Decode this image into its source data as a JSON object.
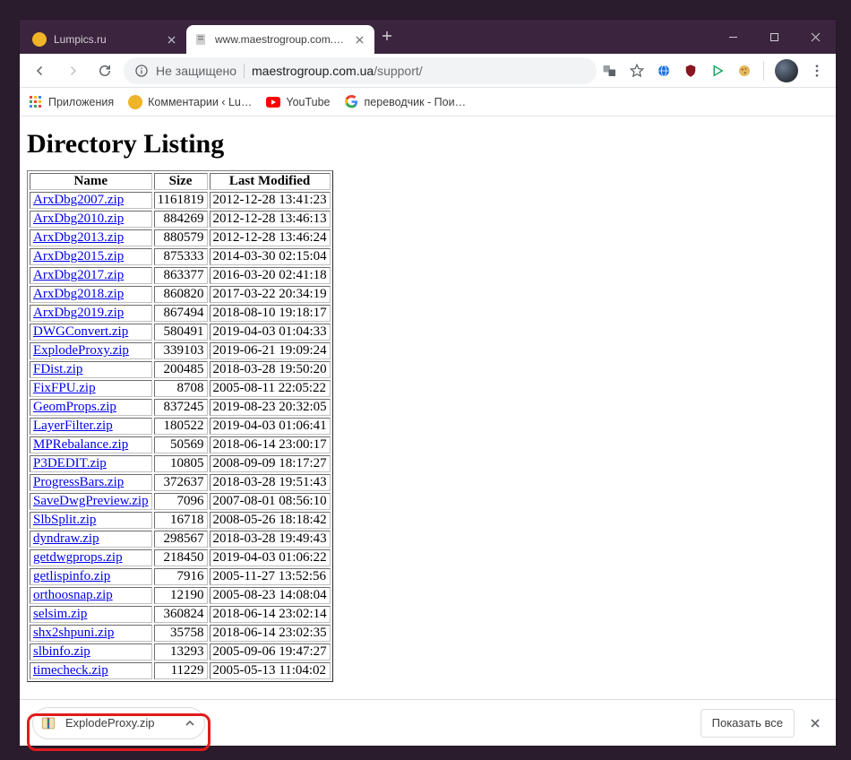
{
  "window": {
    "tabs": [
      {
        "title": "Lumpics.ru",
        "active": false,
        "favicon_color": "#f0b429"
      },
      {
        "title": "www.maestrogroup.com.ua/supp",
        "active": true
      }
    ]
  },
  "toolbar": {
    "secure_label": "Не защищено",
    "url_host": "maestrogroup.com.ua",
    "url_path": "/support/"
  },
  "bookmarks": [
    {
      "label": "Приложения",
      "icon": "apps"
    },
    {
      "label": "Комментарии ‹ Lu…",
      "icon": "lumpics"
    },
    {
      "label": "YouTube",
      "icon": "youtube"
    },
    {
      "label": "переводчик - Пои…",
      "icon": "google-g"
    }
  ],
  "page": {
    "heading": "Directory Listing",
    "columns": [
      "Name",
      "Size",
      "Last Modified"
    ],
    "rows": [
      {
        "name": "ArxDbg2007.zip",
        "size": "1161819",
        "date": "2012-12-28 13:41:23"
      },
      {
        "name": "ArxDbg2010.zip",
        "size": "884269",
        "date": "2012-12-28 13:46:13"
      },
      {
        "name": "ArxDbg2013.zip",
        "size": "880579",
        "date": "2012-12-28 13:46:24"
      },
      {
        "name": "ArxDbg2015.zip",
        "size": "875333",
        "date": "2014-03-30 02:15:04"
      },
      {
        "name": "ArxDbg2017.zip",
        "size": "863377",
        "date": "2016-03-20 02:41:18"
      },
      {
        "name": "ArxDbg2018.zip",
        "size": "860820",
        "date": "2017-03-22 20:34:19"
      },
      {
        "name": "ArxDbg2019.zip",
        "size": "867494",
        "date": "2018-08-10 19:18:17"
      },
      {
        "name": "DWGConvert.zip",
        "size": "580491",
        "date": "2019-04-03 01:04:33"
      },
      {
        "name": "ExplodeProxy.zip",
        "size": "339103",
        "date": "2019-06-21 19:09:24"
      },
      {
        "name": "FDist.zip",
        "size": "200485",
        "date": "2018-03-28 19:50:20"
      },
      {
        "name": "FixFPU.zip",
        "size": "8708",
        "date": "2005-08-11 22:05:22"
      },
      {
        "name": "GeomProps.zip",
        "size": "837245",
        "date": "2019-08-23 20:32:05"
      },
      {
        "name": "LayerFilter.zip",
        "size": "180522",
        "date": "2019-04-03 01:06:41"
      },
      {
        "name": "MPRebalance.zip",
        "size": "50569",
        "date": "2018-06-14 23:00:17"
      },
      {
        "name": "P3DEDIT.zip",
        "size": "10805",
        "date": "2008-09-09 18:17:27"
      },
      {
        "name": "ProgressBars.zip",
        "size": "372637",
        "date": "2018-03-28 19:51:43"
      },
      {
        "name": "SaveDwgPreview.zip",
        "size": "7096",
        "date": "2007-08-01 08:56:10"
      },
      {
        "name": "SlbSplit.zip",
        "size": "16718",
        "date": "2008-05-26 18:18:42"
      },
      {
        "name": "dyndraw.zip",
        "size": "298567",
        "date": "2018-03-28 19:49:43"
      },
      {
        "name": "getdwgprops.zip",
        "size": "218450",
        "date": "2019-04-03 01:06:22"
      },
      {
        "name": "getlispinfo.zip",
        "size": "7916",
        "date": "2005-11-27 13:52:56"
      },
      {
        "name": "orthoosnap.zip",
        "size": "12190",
        "date": "2005-08-23 14:08:04"
      },
      {
        "name": "selsim.zip",
        "size": "360824",
        "date": "2018-06-14 23:02:14"
      },
      {
        "name": "shx2shpuni.zip",
        "size": "35758",
        "date": "2018-06-14 23:02:35"
      },
      {
        "name": "slbinfo.zip",
        "size": "13293",
        "date": "2005-09-06 19:47:27"
      },
      {
        "name": "timecheck.zip",
        "size": "11229",
        "date": "2005-05-13 11:04:02"
      }
    ]
  },
  "downloads": {
    "chip_label": "ExplodeProxy.zip",
    "show_all_label": "Показать все"
  },
  "icons": {
    "apps_color1": "#ea4335",
    "apps_color2": "#4285f4",
    "apps_color3": "#34a853",
    "apps_color4": "#fbbc05"
  }
}
